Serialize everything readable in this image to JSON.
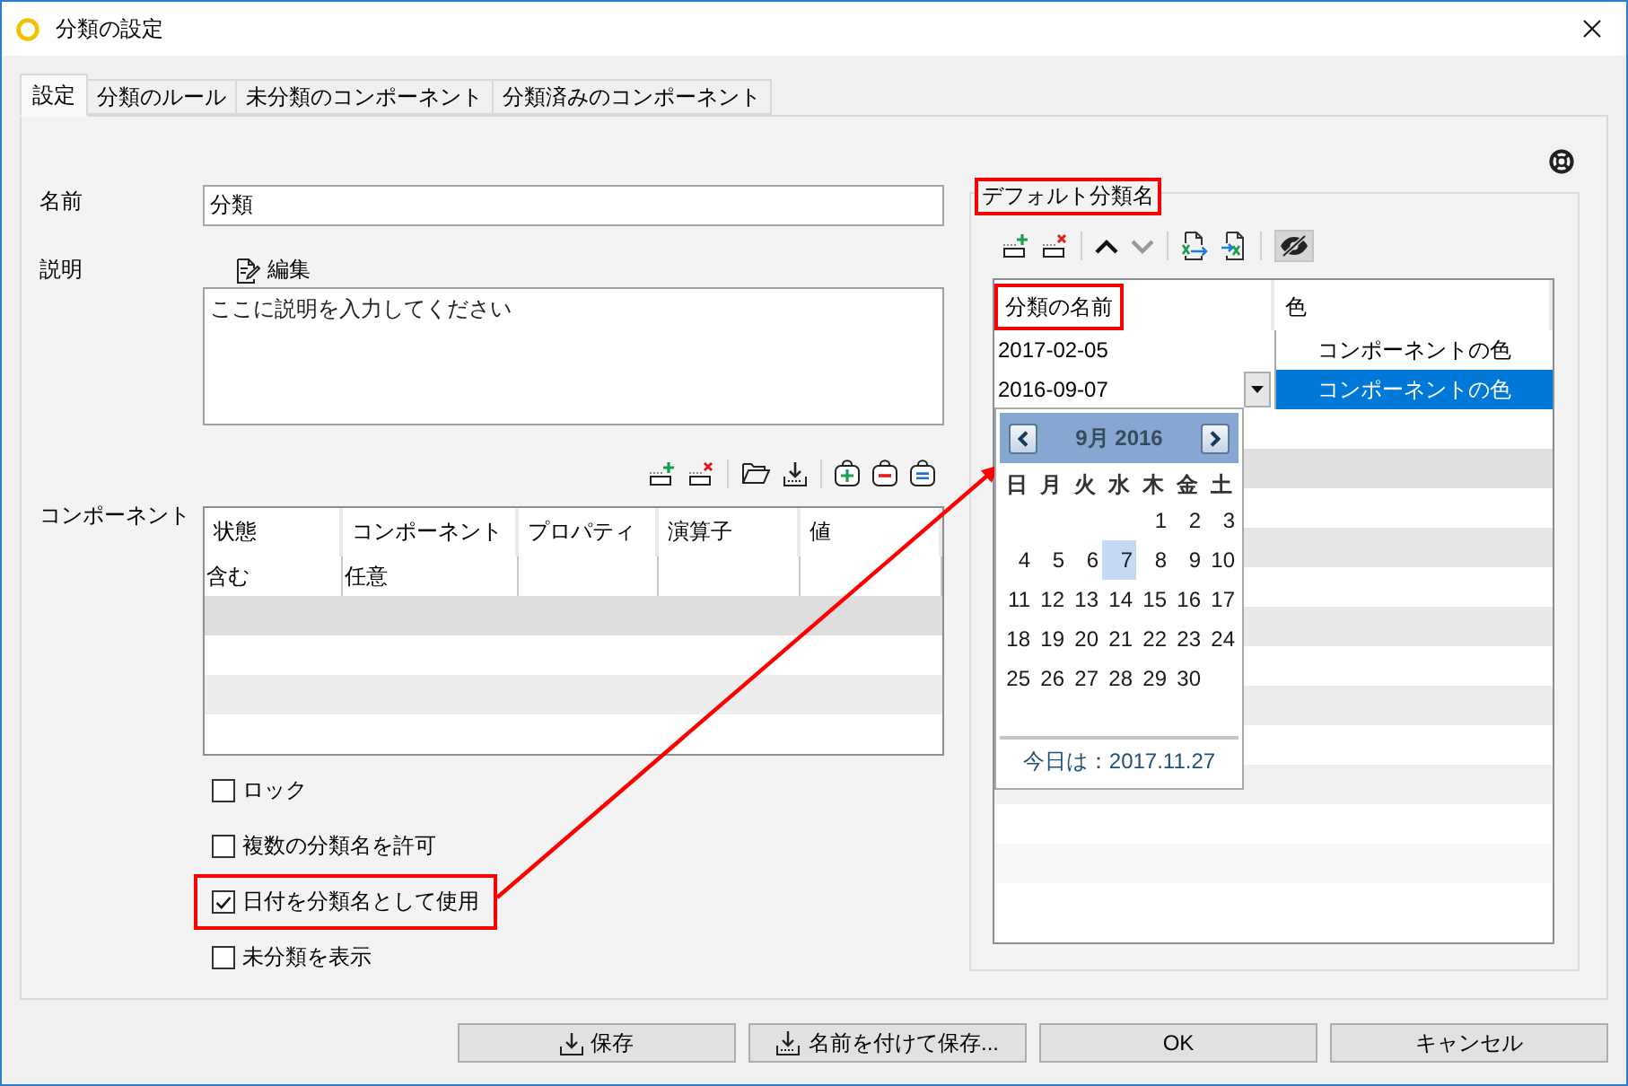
{
  "window": {
    "title": "分類の設定"
  },
  "tabs": [
    {
      "label": "設定",
      "selected": true
    },
    {
      "label": "分類のルール",
      "selected": false
    },
    {
      "label": "未分類のコンポーネント",
      "selected": false
    },
    {
      "label": "分類済みのコンポーネント",
      "selected": false
    }
  ],
  "name_field": {
    "label": "名前",
    "value": "分類"
  },
  "description": {
    "label": "説明",
    "edit_link": "編集",
    "placeholder": "ここに説明を入力してください"
  },
  "components": {
    "label": "コンポーネント",
    "toolbar": [
      {
        "kind": "add-row"
      },
      {
        "kind": "delete-row"
      },
      {
        "kind": "separator"
      },
      {
        "kind": "folder"
      },
      {
        "kind": "download"
      },
      {
        "kind": "separator"
      },
      {
        "kind": "plus-box"
      },
      {
        "kind": "minus-box"
      },
      {
        "kind": "equals-box"
      }
    ],
    "columns": [
      "状態",
      "コンポーネント",
      "プロパティ",
      "演算子",
      "値"
    ],
    "rows": [
      [
        "含む",
        "任意"
      ]
    ]
  },
  "options": [
    {
      "label": "ロック",
      "checked": false,
      "highlighted": false
    },
    {
      "label": "複数の分類名を許可",
      "checked": false,
      "highlighted": false
    },
    {
      "label": "日付を分類名として使用",
      "checked": true,
      "highlighted": true
    },
    {
      "label": "未分類を表示",
      "checked": false,
      "highlighted": false
    }
  ],
  "default_names": {
    "title": "デフォルト分類名",
    "highlighted": true,
    "toolbar": [
      {
        "kind": "add-row",
        "disabled": false
      },
      {
        "kind": "delete-row",
        "disabled": false
      },
      {
        "kind": "separator"
      },
      {
        "kind": "move-up",
        "disabled": false
      },
      {
        "kind": "move-down",
        "disabled": true
      },
      {
        "kind": "separator"
      },
      {
        "kind": "export",
        "disabled": false
      },
      {
        "kind": "import",
        "disabled": false
      },
      {
        "kind": "separator"
      },
      {
        "kind": "hide",
        "disabled": false,
        "pressed": true
      }
    ],
    "columns": [
      {
        "label": "分類の名前",
        "highlighted": true
      },
      {
        "label": "色",
        "highlighted": false
      }
    ],
    "rows": [
      {
        "name": "2017-02-05",
        "color_setting": "コンポーネントの色",
        "selected": false,
        "editing": false
      },
      {
        "name": "2016-09-07",
        "color_setting": "コンポーネントの色",
        "selected": true,
        "editing": true
      }
    ]
  },
  "date_picker": {
    "title": "9月 2016",
    "weekdays": [
      "日",
      "月",
      "火",
      "水",
      "木",
      "金",
      "土"
    ],
    "weeks": [
      {
        "kind": "first",
        "days": [
          {
            "day": "1",
            "selected": false
          },
          {
            "day": "2",
            "selected": false
          },
          {
            "day": "3",
            "selected": false
          }
        ]
      },
      {
        "kind": "full",
        "days": [
          {
            "day": "4",
            "selected": false
          },
          {
            "day": "5",
            "selected": false
          },
          {
            "day": "6",
            "selected": false
          },
          {
            "day": "7",
            "selected": true
          },
          {
            "day": "8",
            "selected": false
          },
          {
            "day": "9",
            "selected": false
          },
          {
            "day": "10",
            "selected": false
          }
        ]
      },
      {
        "kind": "full",
        "days": [
          {
            "day": "11",
            "selected": false
          },
          {
            "day": "12",
            "selected": false
          },
          {
            "day": "13",
            "selected": false
          },
          {
            "day": "14",
            "selected": false
          },
          {
            "day": "15",
            "selected": false
          },
          {
            "day": "16",
            "selected": false
          },
          {
            "day": "17",
            "selected": false
          }
        ]
      },
      {
        "kind": "full",
        "days": [
          {
            "day": "18",
            "selected": false
          },
          {
            "day": "19",
            "selected": false
          },
          {
            "day": "20",
            "selected": false
          },
          {
            "day": "21",
            "selected": false
          },
          {
            "day": "22",
            "selected": false
          },
          {
            "day": "23",
            "selected": false
          },
          {
            "day": "24",
            "selected": false
          }
        ]
      },
      {
        "kind": "last",
        "days": [
          {
            "day": "25",
            "selected": false
          },
          {
            "day": "26",
            "selected": false
          },
          {
            "day": "27",
            "selected": false
          },
          {
            "day": "28",
            "selected": false
          },
          {
            "day": "29",
            "selected": false
          },
          {
            "day": "30",
            "selected": false
          }
        ]
      }
    ],
    "today": "今日は：2017.11.27"
  },
  "annotation_arrow": true,
  "buttons": [
    {
      "label": "保存",
      "kind": "save"
    },
    {
      "label": "名前を付けて保存...",
      "kind": "save-as"
    },
    {
      "label": "OK",
      "kind": "ok"
    },
    {
      "label": "キャンセル",
      "kind": "cancel"
    }
  ]
}
